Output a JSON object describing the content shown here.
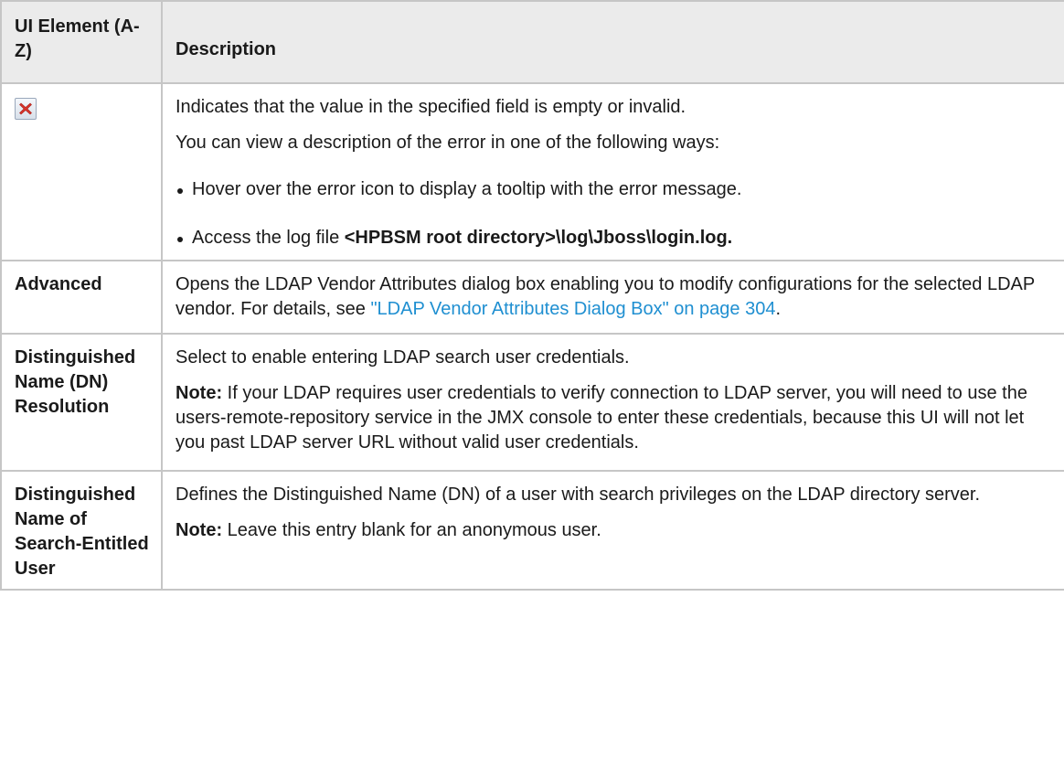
{
  "table": {
    "header": {
      "col1": "UI Element (A-Z)",
      "col2": "Description"
    },
    "rows": [
      {
        "element_icon": "error-x-icon",
        "description": {
          "p1": "Indicates that the value in the specified field is empty or invalid.",
          "p2": "You can view a description of the error in one of the following ways:",
          "bullets": [
            {
              "text": "Hover over the error icon to display a tooltip with the error message."
            },
            {
              "prefix": "Access the log file ",
              "bold": "<HPBSM root directory>\\log\\Jboss\\login.log."
            }
          ]
        }
      },
      {
        "element": "Advanced",
        "description": {
          "text": "Opens the LDAP Vendor Attributes dialog box enabling you to modify configurations for the selected LDAP vendor. For details, see ",
          "link": "\"LDAP Vendor Attributes Dialog Box\" on page 304",
          "suffix": "."
        }
      },
      {
        "element": "Distinguished Name (DN) Resolution",
        "description": {
          "p1": "Select to enable entering LDAP search user credentials.",
          "note_label": "Note:",
          "note_text": " If your LDAP requires user credentials to verify connection to LDAP server, you will need to use the users-remote-repository service in the JMX console to enter these credentials, because this UI will not let you past LDAP server URL without valid user credentials."
        }
      },
      {
        "element": "Distinguished Name of Search-Entitled User",
        "description": {
          "p1": "Defines the Distinguished Name (DN) of a user with search privileges on the LDAP directory server.",
          "note_label": "Note:",
          "note_text": " Leave this entry blank for an anonymous user."
        }
      }
    ]
  },
  "colors": {
    "header_bg": "#ebebeb",
    "border": "#c6c6c6",
    "link": "#1f8fd1",
    "error_red": "#d9342b"
  }
}
